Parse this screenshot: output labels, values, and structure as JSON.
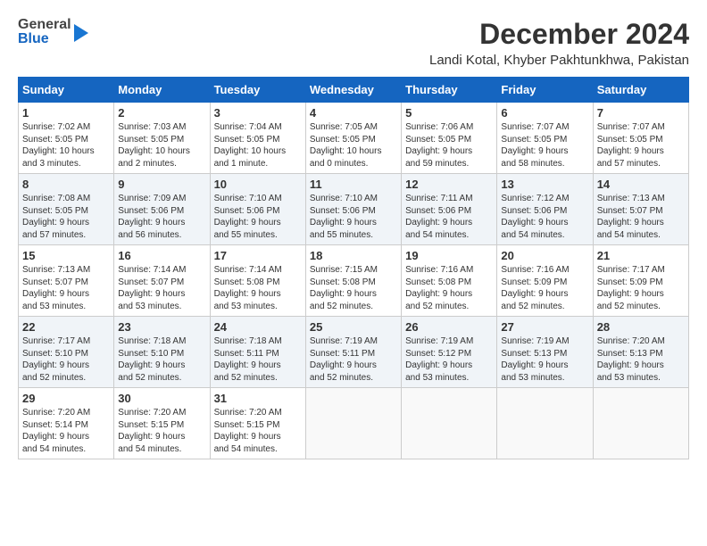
{
  "logo": {
    "general": "General",
    "blue": "Blue"
  },
  "title": "December 2024",
  "location": "Landi Kotal, Khyber Pakhtunkhwa, Pakistan",
  "headers": [
    "Sunday",
    "Monday",
    "Tuesday",
    "Wednesday",
    "Thursday",
    "Friday",
    "Saturday"
  ],
  "weeks": [
    [
      {
        "day": "1",
        "info": "Sunrise: 7:02 AM\nSunset: 5:05 PM\nDaylight: 10 hours\nand 3 minutes."
      },
      {
        "day": "2",
        "info": "Sunrise: 7:03 AM\nSunset: 5:05 PM\nDaylight: 10 hours\nand 2 minutes."
      },
      {
        "day": "3",
        "info": "Sunrise: 7:04 AM\nSunset: 5:05 PM\nDaylight: 10 hours\nand 1 minute."
      },
      {
        "day": "4",
        "info": "Sunrise: 7:05 AM\nSunset: 5:05 PM\nDaylight: 10 hours\nand 0 minutes."
      },
      {
        "day": "5",
        "info": "Sunrise: 7:06 AM\nSunset: 5:05 PM\nDaylight: 9 hours\nand 59 minutes."
      },
      {
        "day": "6",
        "info": "Sunrise: 7:07 AM\nSunset: 5:05 PM\nDaylight: 9 hours\nand 58 minutes."
      },
      {
        "day": "7",
        "info": "Sunrise: 7:07 AM\nSunset: 5:05 PM\nDaylight: 9 hours\nand 57 minutes."
      }
    ],
    [
      {
        "day": "8",
        "info": "Sunrise: 7:08 AM\nSunset: 5:05 PM\nDaylight: 9 hours\nand 57 minutes."
      },
      {
        "day": "9",
        "info": "Sunrise: 7:09 AM\nSunset: 5:06 PM\nDaylight: 9 hours\nand 56 minutes."
      },
      {
        "day": "10",
        "info": "Sunrise: 7:10 AM\nSunset: 5:06 PM\nDaylight: 9 hours\nand 55 minutes."
      },
      {
        "day": "11",
        "info": "Sunrise: 7:10 AM\nSunset: 5:06 PM\nDaylight: 9 hours\nand 55 minutes."
      },
      {
        "day": "12",
        "info": "Sunrise: 7:11 AM\nSunset: 5:06 PM\nDaylight: 9 hours\nand 54 minutes."
      },
      {
        "day": "13",
        "info": "Sunrise: 7:12 AM\nSunset: 5:06 PM\nDaylight: 9 hours\nand 54 minutes."
      },
      {
        "day": "14",
        "info": "Sunrise: 7:13 AM\nSunset: 5:07 PM\nDaylight: 9 hours\nand 54 minutes."
      }
    ],
    [
      {
        "day": "15",
        "info": "Sunrise: 7:13 AM\nSunset: 5:07 PM\nDaylight: 9 hours\nand 53 minutes."
      },
      {
        "day": "16",
        "info": "Sunrise: 7:14 AM\nSunset: 5:07 PM\nDaylight: 9 hours\nand 53 minutes."
      },
      {
        "day": "17",
        "info": "Sunrise: 7:14 AM\nSunset: 5:08 PM\nDaylight: 9 hours\nand 53 minutes."
      },
      {
        "day": "18",
        "info": "Sunrise: 7:15 AM\nSunset: 5:08 PM\nDaylight: 9 hours\nand 52 minutes."
      },
      {
        "day": "19",
        "info": "Sunrise: 7:16 AM\nSunset: 5:08 PM\nDaylight: 9 hours\nand 52 minutes."
      },
      {
        "day": "20",
        "info": "Sunrise: 7:16 AM\nSunset: 5:09 PM\nDaylight: 9 hours\nand 52 minutes."
      },
      {
        "day": "21",
        "info": "Sunrise: 7:17 AM\nSunset: 5:09 PM\nDaylight: 9 hours\nand 52 minutes."
      }
    ],
    [
      {
        "day": "22",
        "info": "Sunrise: 7:17 AM\nSunset: 5:10 PM\nDaylight: 9 hours\nand 52 minutes."
      },
      {
        "day": "23",
        "info": "Sunrise: 7:18 AM\nSunset: 5:10 PM\nDaylight: 9 hours\nand 52 minutes."
      },
      {
        "day": "24",
        "info": "Sunrise: 7:18 AM\nSunset: 5:11 PM\nDaylight: 9 hours\nand 52 minutes."
      },
      {
        "day": "25",
        "info": "Sunrise: 7:19 AM\nSunset: 5:11 PM\nDaylight: 9 hours\nand 52 minutes."
      },
      {
        "day": "26",
        "info": "Sunrise: 7:19 AM\nSunset: 5:12 PM\nDaylight: 9 hours\nand 53 minutes."
      },
      {
        "day": "27",
        "info": "Sunrise: 7:19 AM\nSunset: 5:13 PM\nDaylight: 9 hours\nand 53 minutes."
      },
      {
        "day": "28",
        "info": "Sunrise: 7:20 AM\nSunset: 5:13 PM\nDaylight: 9 hours\nand 53 minutes."
      }
    ],
    [
      {
        "day": "29",
        "info": "Sunrise: 7:20 AM\nSunset: 5:14 PM\nDaylight: 9 hours\nand 54 minutes."
      },
      {
        "day": "30",
        "info": "Sunrise: 7:20 AM\nSunset: 5:15 PM\nDaylight: 9 hours\nand 54 minutes."
      },
      {
        "day": "31",
        "info": "Sunrise: 7:20 AM\nSunset: 5:15 PM\nDaylight: 9 hours\nand 54 minutes."
      },
      {
        "day": "",
        "info": ""
      },
      {
        "day": "",
        "info": ""
      },
      {
        "day": "",
        "info": ""
      },
      {
        "day": "",
        "info": ""
      }
    ]
  ]
}
